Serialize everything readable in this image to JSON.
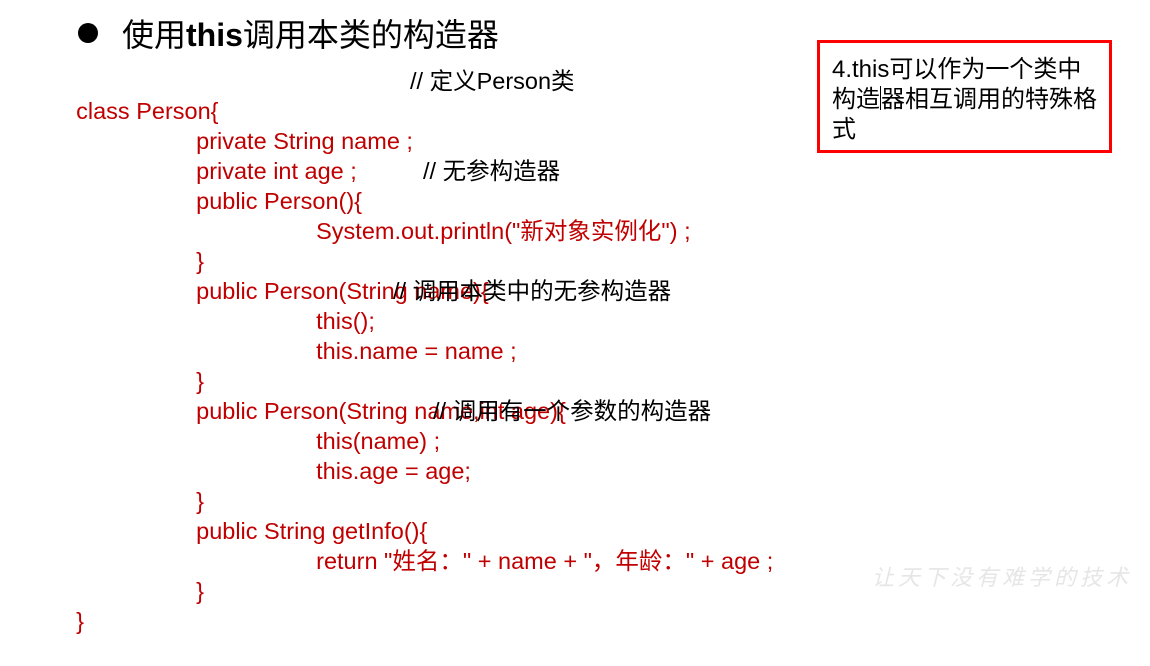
{
  "slide": {
    "title_prefix": "使用",
    "title_keyword": "this",
    "title_suffix": "调用本类的构造器"
  },
  "code": {
    "lines": [
      {
        "code": "class Person{",
        "comment": "// 定义Person类"
      },
      {
        "code": "private String name ;",
        "comment": ""
      },
      {
        "code": "private int age ;",
        "comment": ""
      },
      {
        "code": "public Person(){",
        "comment": "// 无参构造器"
      },
      {
        "code": "System.out.println(\"新对象实例化\") ;",
        "comment": ""
      },
      {
        "code": "}",
        "comment": ""
      },
      {
        "code": "public Person(String name){",
        "comment": ""
      },
      {
        "code": "this();",
        "comment": "// 调用本类中的无参构造器"
      },
      {
        "code": "this.name = name ;",
        "comment": ""
      },
      {
        "code": "}",
        "comment": ""
      },
      {
        "code": "public Person(String name,int age){",
        "comment": ""
      },
      {
        "code": "this(name) ;",
        "comment": "// 调用有一个参数的构造器"
      },
      {
        "code": "this.age = age;",
        "comment": ""
      },
      {
        "code": "}",
        "comment": ""
      },
      {
        "code": "public String getInfo(){",
        "comment": ""
      },
      {
        "code": "return \"姓名：\" + name + \"，年龄：\" + age ;",
        "comment": ""
      },
      {
        "code": "}",
        "comment": ""
      },
      {
        "code": "}",
        "comment": ""
      }
    ]
  },
  "note": {
    "text_before_caret": "4.this可以作为一个类中构造",
    "text_after_caret": "器相互调用的特殊格式"
  },
  "watermark": "让天下没有难学的技术",
  "colors": {
    "code": "#C00000",
    "comment": "#000000",
    "note_border": "#FF0000"
  }
}
